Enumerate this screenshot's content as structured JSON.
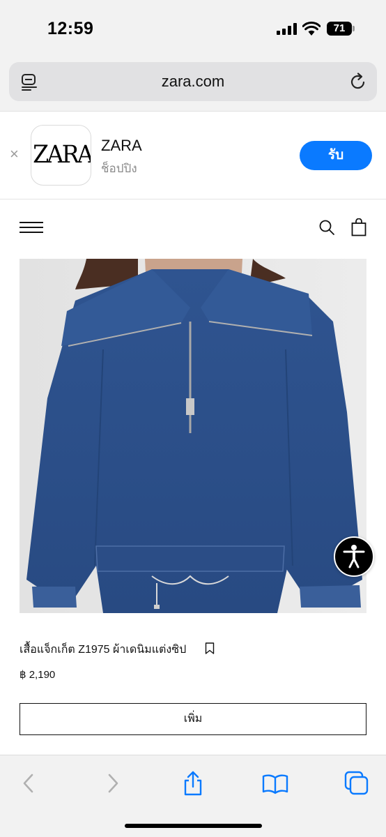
{
  "status_bar": {
    "time": "12:59",
    "battery": "71"
  },
  "browser": {
    "url": "zara.com"
  },
  "app_banner": {
    "close_symbol": "×",
    "icon_logo_text": "ZARA",
    "app_name": "ZARA",
    "app_subtitle": "ช็อปปิง",
    "get_label": "รับ"
  },
  "site_header": {
    "menu_icon": "hamburger-icon",
    "search_icon": "search-icon",
    "bag_icon": "shopping-bag-icon"
  },
  "product": {
    "name": "เสื้อแจ็กเก็ต Z1975 ผ้าเดนิมแต่งซิป",
    "price": "฿ 2,190",
    "add_label": "เพิ่ม"
  },
  "colors": {
    "accent": "#0a7aff",
    "denim": "#2c4f88",
    "toolbar_icon": "#0a7aff",
    "toolbar_icon_disabled": "#b0b0b0"
  },
  "toolbar": {
    "icons": [
      "back-icon",
      "forward-icon",
      "share-icon",
      "bookmarks-icon",
      "tabs-icon"
    ]
  }
}
